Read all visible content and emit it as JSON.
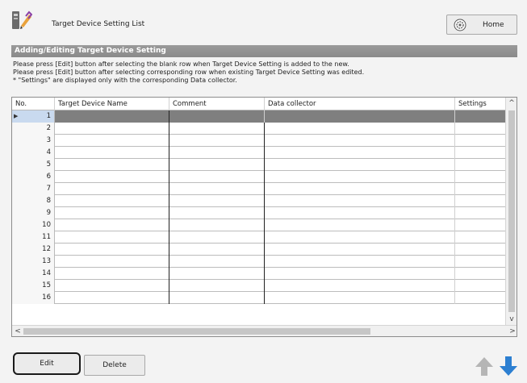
{
  "header": {
    "title": "Target Device Setting List",
    "home_label": "Home"
  },
  "section": {
    "title": "Adding/Editing Target Device Setting"
  },
  "instructions": [
    "Please press [Edit] button after selecting the blank row when Target Device Setting is added to the new.",
    "Please press [Edit] button after selecting corresponding row when existing Target Device Setting was edited.",
    "* \"Settings\" are displayed only with the corresponding Data collector."
  ],
  "table": {
    "columns": [
      "No.",
      "Target Device Name",
      "Comment",
      "Data collector",
      "Settings"
    ],
    "rows": [
      "1",
      "2",
      "3",
      "4",
      "5",
      "6",
      "7",
      "8",
      "9",
      "10",
      "11",
      "12",
      "13",
      "14",
      "15",
      "16"
    ],
    "selected_row": "1"
  },
  "buttons": {
    "edit": "Edit",
    "delete": "Delete"
  },
  "colors": {
    "section_bar": "#8f8f8f",
    "selected_row": "#7f7f7f",
    "move_up_disabled": "#b5b5b5",
    "move_down": "#2c7fd1"
  },
  "icons": {
    "app": "device-setting-icon",
    "home": "home-gear-icon",
    "up": "arrow-up-icon",
    "down": "arrow-down-icon"
  }
}
